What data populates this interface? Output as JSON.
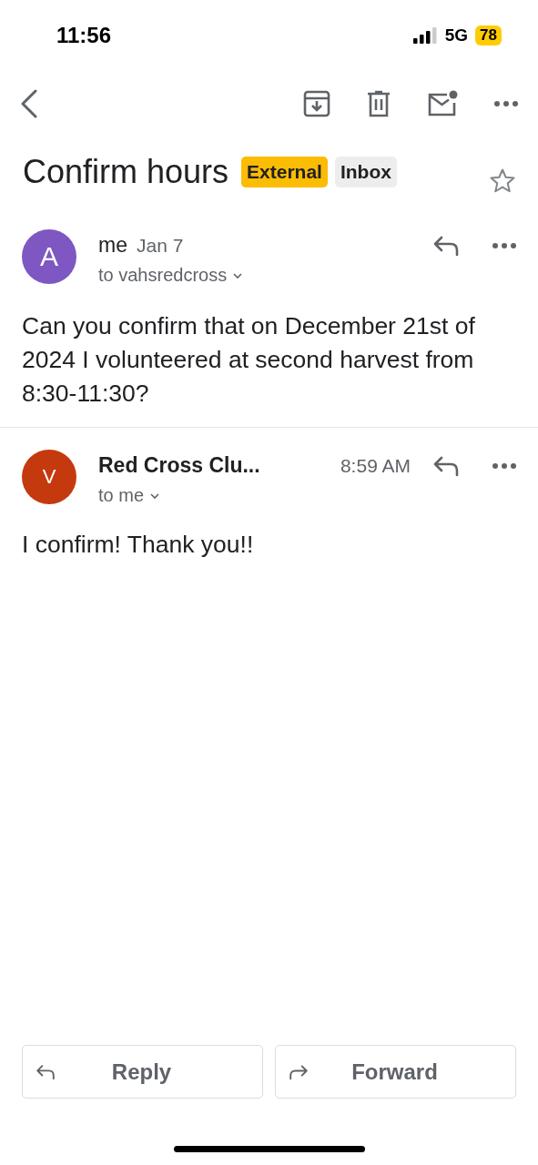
{
  "status_bar": {
    "time": "11:56",
    "network": "5G",
    "battery": "78"
  },
  "subject": "Confirm hours",
  "labels": [
    {
      "text": "External",
      "color": "#fbbc04"
    },
    {
      "text": "Inbox",
      "color": "#ededed"
    }
  ],
  "starred": false,
  "messages": [
    {
      "avatar": "A",
      "color": "#7e57c2",
      "sender": "me",
      "sender_bold": false,
      "date": "Jan 7",
      "recipient": "to vahsredcross",
      "body": "Can you confirm that on December 21st of 2024 I volunteered at second harvest from 8:30-11:30?"
    },
    {
      "avatar": "V",
      "color": "#c5390f",
      "sender": "Red Cross Clu...",
      "sender_bold": true,
      "date": "8:59 AM",
      "recipient": "to me",
      "body": "I confirm! Thank you!!"
    }
  ],
  "actions": [
    {
      "kind": "reply",
      "label": "Reply"
    },
    {
      "kind": "forward",
      "label": "Forward"
    }
  ]
}
